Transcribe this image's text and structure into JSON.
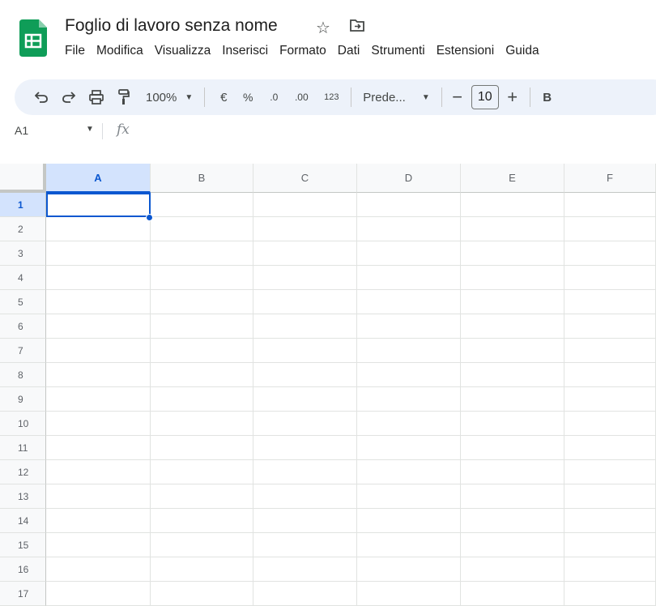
{
  "app": {
    "title": "Foglio di lavoro senza nome",
    "brand_color": "#0f9d58"
  },
  "menu": [
    "File",
    "Modifica",
    "Visualizza",
    "Inserisci",
    "Formato",
    "Dati",
    "Strumenti",
    "Estensioni",
    "Guida"
  ],
  "toolbar": {
    "zoom": "100%",
    "currency": "€",
    "percent": "%",
    "decrease_decimals": ".0",
    "increase_decimals": ".00",
    "number_format": "123",
    "font": "Prede...",
    "font_size": "10",
    "decrease_font": "−",
    "increase_font": "+",
    "bold": "B"
  },
  "formula_bar": {
    "cell_ref": "A1",
    "fx": "fx"
  },
  "grid": {
    "columns": [
      "A",
      "B",
      "C",
      "D",
      "E",
      "F"
    ],
    "rows": [
      "1",
      "2",
      "3",
      "4",
      "5",
      "6",
      "7",
      "8",
      "9",
      "10",
      "11",
      "12",
      "13",
      "14",
      "15",
      "16",
      "17"
    ],
    "selected_cell": "A1",
    "selection_color": "#0b57d0"
  }
}
